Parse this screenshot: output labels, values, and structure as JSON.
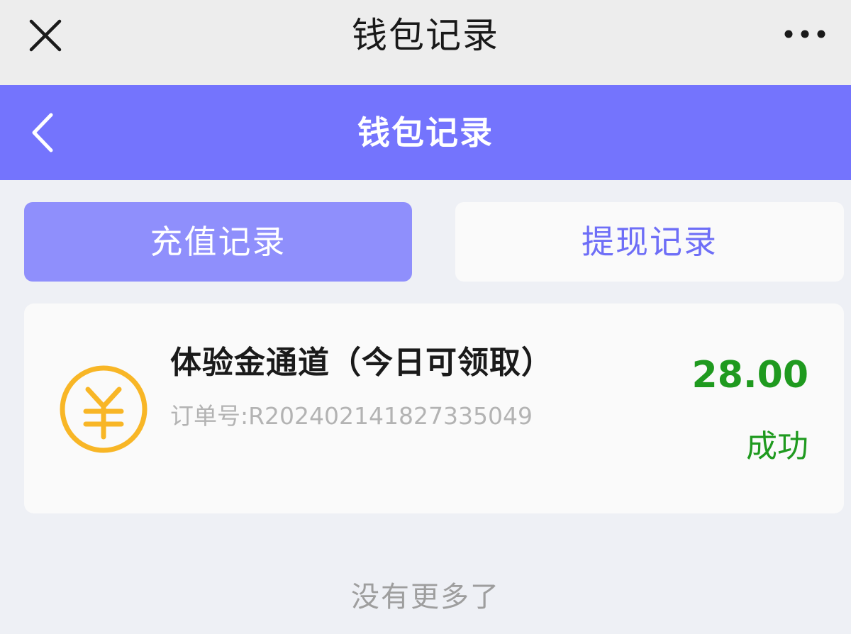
{
  "wechat_bar": {
    "title": "钱包记录",
    "close_icon": "close-icon",
    "more_icon": "more-dots-icon"
  },
  "app_bar": {
    "title": "钱包记录",
    "back_icon": "chevron-left-icon",
    "background": "#7474fd"
  },
  "tabs": [
    {
      "label": "充值记录",
      "active": true
    },
    {
      "label": "提现记录",
      "active": false
    }
  ],
  "records": [
    {
      "icon": "yuan-coin-icon",
      "title": "体验金通道（今日可领取）",
      "order_no": "订单号:R2024021418273350​49",
      "amount": "28.00",
      "status": "成功"
    }
  ],
  "footer": {
    "no_more": "没有更多了"
  },
  "colors": {
    "accent": "#7474fd",
    "active_tab": "#8f8ffc",
    "success": "#1f9a1f",
    "coin": "#f8b626"
  }
}
